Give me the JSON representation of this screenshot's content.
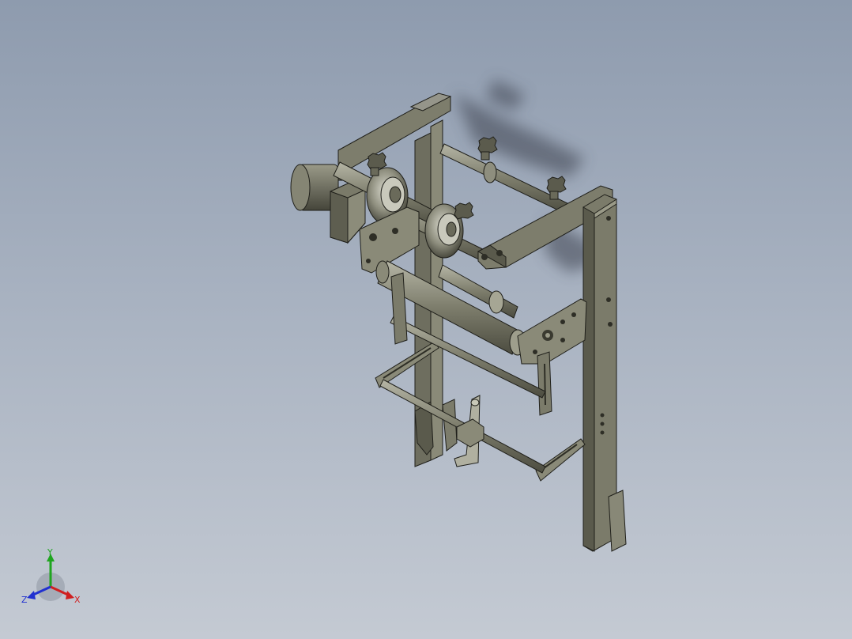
{
  "viewport": {
    "colors": {
      "background_top": "#8e9bae",
      "background_bottom": "#c4cad3",
      "part_face": "#6e6e5f",
      "part_light": "#8a8a78",
      "part_dark": "#4a4a3e",
      "edge": "#1f1f1a",
      "shadow": "#3c4350"
    }
  },
  "triad": {
    "x_label": "X",
    "y_label": "Y",
    "z_label": "Z",
    "x_color": "#d02020",
    "y_color": "#1fa51f",
    "z_color": "#2030d0"
  },
  "model": {
    "icon": "cad-assembly-model"
  }
}
